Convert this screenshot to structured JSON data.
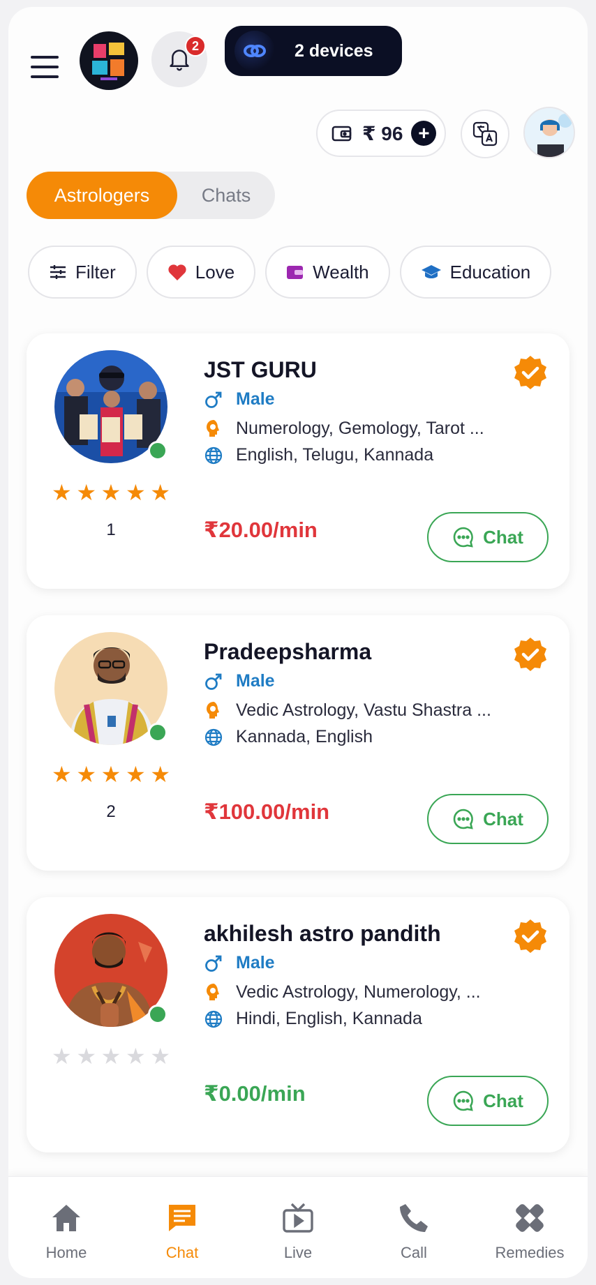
{
  "header": {
    "notification_count": "2",
    "devices_label": "2 devices",
    "wallet_currency": "₹",
    "wallet_amount": "96"
  },
  "tabs": [
    {
      "label": "Astrologers",
      "active": true
    },
    {
      "label": "Chats",
      "active": false
    }
  ],
  "filters": [
    {
      "label": "Filter",
      "icon": "sliders-icon"
    },
    {
      "label": "Love",
      "icon": "heart-icon"
    },
    {
      "label": "Wealth",
      "icon": "wallet-icon"
    },
    {
      "label": "Education",
      "icon": "graduation-cap-icon"
    }
  ],
  "astrologers": [
    {
      "name": "JST GURU",
      "gender": "Male",
      "skills": "Numerology, Gemology, Tarot ...",
      "languages": "English, Telugu, Kannada",
      "price": "₹20.00/min",
      "price_color": "#e0363b",
      "rating_stars": 5,
      "rating_count": "1",
      "online": true,
      "chat_label": "Chat"
    },
    {
      "name": "Pradeepsharma",
      "gender": "Male",
      "skills": "Vedic Astrology, Vastu Shastra ...",
      "languages": "Kannada, English",
      "price": "₹100.00/min",
      "price_color": "#e0363b",
      "rating_stars": 5,
      "rating_count": "2",
      "online": true,
      "chat_label": "Chat"
    },
    {
      "name": "akhilesh astro pandith",
      "gender": "Male",
      "skills": "Vedic Astrology, Numerology, ...",
      "languages": "Hindi, English, Kannada",
      "price": "₹0.00/min",
      "price_color": "#3aa655",
      "rating_stars": 0,
      "rating_count": "",
      "online": true,
      "chat_label": "Chat"
    }
  ],
  "bottom_nav": [
    {
      "label": "Home",
      "icon": "home-icon",
      "active": false
    },
    {
      "label": "Chat",
      "icon": "chat-icon",
      "active": true
    },
    {
      "label": "Live",
      "icon": "tv-icon",
      "active": false
    },
    {
      "label": "Call",
      "icon": "phone-icon",
      "active": false
    },
    {
      "label": "Remedies",
      "icon": "bandage-icon",
      "active": false
    }
  ],
  "colors": {
    "accent": "#f58a07",
    "online": "#3aa655",
    "gender": "#1f7cc4",
    "dark": "#0b0f24"
  }
}
